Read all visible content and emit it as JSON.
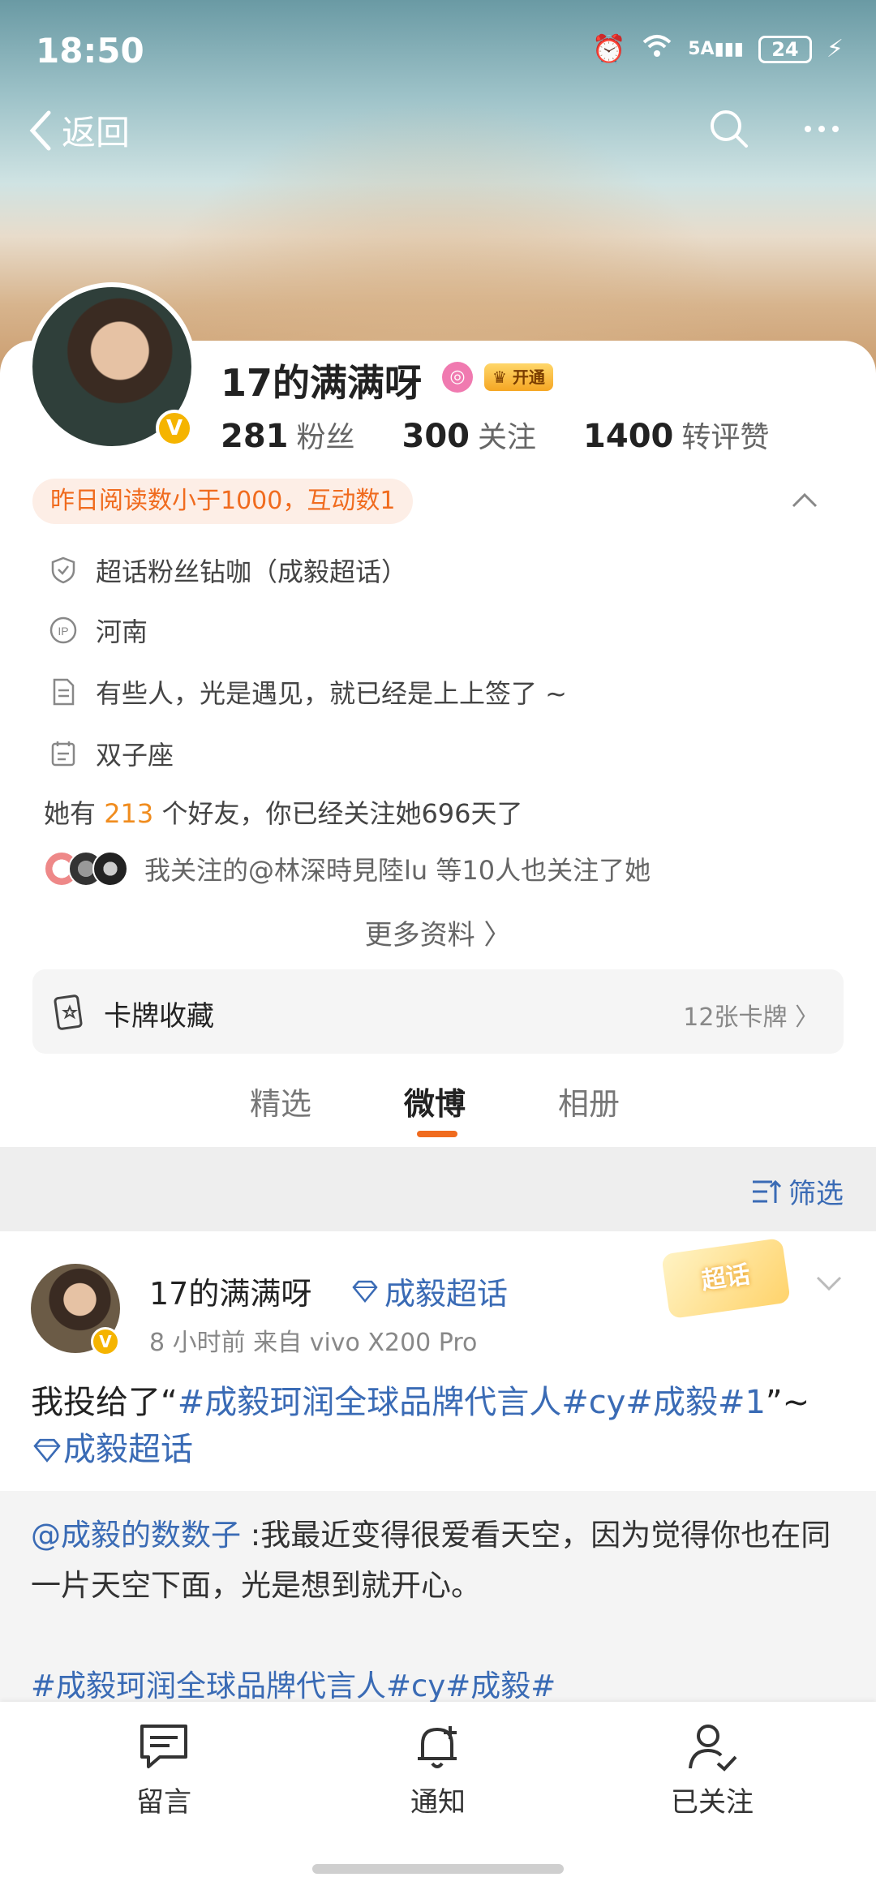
{
  "status": {
    "time": "18:50",
    "battery": "24",
    "network": "5A"
  },
  "nav": {
    "back_label": "返回"
  },
  "profile": {
    "name": "17的满满呀",
    "vip_badge": "开通",
    "stats": {
      "fans_count": "281",
      "fans_label": "粉丝",
      "follow_count": "300",
      "follow_label": "关注",
      "likes_count": "1400",
      "likes_label": "转评赞"
    },
    "alert": "昨日阅读数小于1000，互动数1",
    "info": {
      "supertopic": "超话粉丝钻咖（成毅超话）",
      "ip": "河南",
      "bio": "有些人，光是遇见，就已经是上上签了 ~",
      "zodiac": "双子座"
    },
    "friends_prefix": "她有",
    "friends_count": "213",
    "friends_suffix": "个好友，你已经关注她696天了",
    "mutual": "我关注的@林深時見陸lu 等10人也关注了她",
    "more_info": "更多资料 〉",
    "cards_label": "卡牌收藏",
    "cards_count": "12张卡牌 〉"
  },
  "tabs": [
    "精选",
    "微博",
    "相册"
  ],
  "filter_label": "筛选",
  "post": {
    "name": "17的满满呀",
    "topic": "成毅超话",
    "meta": "8 小时前  来自 vivo X200 Pro",
    "chaohua_tag": "超话",
    "text_prefix": "我投给了“",
    "text_tag1": "#成毅珂润全球品牌代言人#cy#成毅#1",
    "text_mid": "”~",
    "text_topic": "成毅超话",
    "quote_mention": "@成毅的数数子",
    "quote_text": " :我最近变得很爱看天空，因为觉得你也在同一片天空下面，光是想到就开心。",
    "quote_tags": "#成毅珂润全球品牌代言人#cy#成毅#"
  },
  "bottom": {
    "comment": "留言",
    "notify": "通知",
    "followed": "已关注"
  },
  "colors": {
    "accent_orange": "#f06b1e",
    "link_blue": "#3a6bb5",
    "gold": "#f5b400"
  }
}
